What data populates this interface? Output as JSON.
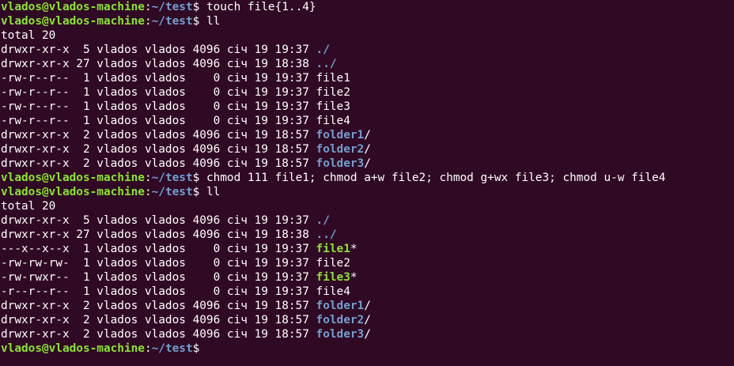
{
  "terminal": {
    "prompt": {
      "user_host": "vlados@vlados-machine",
      "colon": ":",
      "path": "~/test",
      "symbol": "$"
    },
    "colors": {
      "background": "#300a24",
      "text": "#ffffff",
      "prompt_user": "#8ae234",
      "prompt_path": "#729fcf",
      "directory": "#729fcf",
      "executable": "#8ae234"
    },
    "lines": [
      {
        "kind": "prompt",
        "command": " touch file{1..4}"
      },
      {
        "kind": "prompt",
        "command": " ll"
      },
      {
        "kind": "text",
        "text": "total 20"
      },
      {
        "kind": "entry",
        "meta": "drwxr-xr-x  5 vlados vlados 4096 січ 19 19:37 ",
        "name": "./",
        "class": "dir",
        "suffix": ""
      },
      {
        "kind": "entry",
        "meta": "drwxr-xr-x 27 vlados vlados 4096 січ 19 18:38 ",
        "name": "../",
        "class": "dir",
        "suffix": ""
      },
      {
        "kind": "entry",
        "meta": "-rw-r--r--  1 vlados vlados    0 січ 19 19:37 ",
        "name": "file1",
        "class": "plain",
        "suffix": ""
      },
      {
        "kind": "entry",
        "meta": "-rw-r--r--  1 vlados vlados    0 січ 19 19:37 ",
        "name": "file2",
        "class": "plain",
        "suffix": ""
      },
      {
        "kind": "entry",
        "meta": "-rw-r--r--  1 vlados vlados    0 січ 19 19:37 ",
        "name": "file3",
        "class": "plain",
        "suffix": ""
      },
      {
        "kind": "entry",
        "meta": "-rw-r--r--  1 vlados vlados    0 січ 19 19:37 ",
        "name": "file4",
        "class": "plain",
        "suffix": ""
      },
      {
        "kind": "entry",
        "meta": "drwxr-xr-x  2 vlados vlados 4096 січ 19 18:57 ",
        "name": "folder1",
        "class": "dir",
        "suffix": "/"
      },
      {
        "kind": "entry",
        "meta": "drwxr-xr-x  2 vlados vlados 4096 січ 19 18:57 ",
        "name": "folder2",
        "class": "dir",
        "suffix": "/"
      },
      {
        "kind": "entry",
        "meta": "drwxr-xr-x  2 vlados vlados 4096 січ 19 18:57 ",
        "name": "folder3",
        "class": "dir",
        "suffix": "/"
      },
      {
        "kind": "prompt",
        "command": " chmod 111 file1; chmod a+w file2; chmod g+wx file3; chmod u-w file4"
      },
      {
        "kind": "prompt",
        "command": " ll"
      },
      {
        "kind": "text",
        "text": "total 20"
      },
      {
        "kind": "entry",
        "meta": "drwxr-xr-x  5 vlados vlados 4096 січ 19 19:37 ",
        "name": "./",
        "class": "dir",
        "suffix": ""
      },
      {
        "kind": "entry",
        "meta": "drwxr-xr-x 27 vlados vlados 4096 січ 19 18:38 ",
        "name": "../",
        "class": "dir",
        "suffix": ""
      },
      {
        "kind": "entry",
        "meta": "---x--x--x  1 vlados vlados    0 січ 19 19:37 ",
        "name": "file1",
        "class": "exe",
        "suffix": "*"
      },
      {
        "kind": "entry",
        "meta": "-rw-rw-rw-  1 vlados vlados    0 січ 19 19:37 ",
        "name": "file2",
        "class": "plain",
        "suffix": ""
      },
      {
        "kind": "entry",
        "meta": "-rw-rwxr--  1 vlados vlados    0 січ 19 19:37 ",
        "name": "file3",
        "class": "exe",
        "suffix": "*"
      },
      {
        "kind": "entry",
        "meta": "-r--r--r--  1 vlados vlados    0 січ 19 19:37 ",
        "name": "file4",
        "class": "plain",
        "suffix": ""
      },
      {
        "kind": "entry",
        "meta": "drwxr-xr-x  2 vlados vlados 4096 січ 19 18:57 ",
        "name": "folder1",
        "class": "dir",
        "suffix": "/"
      },
      {
        "kind": "entry",
        "meta": "drwxr-xr-x  2 vlados vlados 4096 січ 19 18:57 ",
        "name": "folder2",
        "class": "dir",
        "suffix": "/"
      },
      {
        "kind": "entry",
        "meta": "drwxr-xr-x  2 vlados vlados 4096 січ 19 18:57 ",
        "name": "folder3",
        "class": "dir",
        "suffix": "/"
      },
      {
        "kind": "prompt",
        "command": ""
      }
    ]
  }
}
